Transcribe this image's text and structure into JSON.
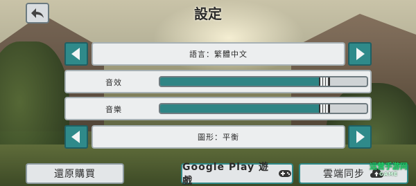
{
  "header": {
    "title": "設定",
    "back_icon": "back-arrow-icon"
  },
  "language": {
    "label": "語言：繁體中文"
  },
  "sound": {
    "label": "音效",
    "level": 0.8
  },
  "music": {
    "label": "音樂",
    "level": 0.8
  },
  "graphics": {
    "label": "圖形：平衡"
  },
  "buttons": {
    "restore": "還原購買",
    "google_play": "Google Play 遊戲",
    "cloud": "雲端同步"
  },
  "watermark": {
    "text": "运营手游网",
    "sub": "GAME"
  },
  "colors": {
    "accent": "#2f8a8a",
    "panel": "#eceeef"
  }
}
